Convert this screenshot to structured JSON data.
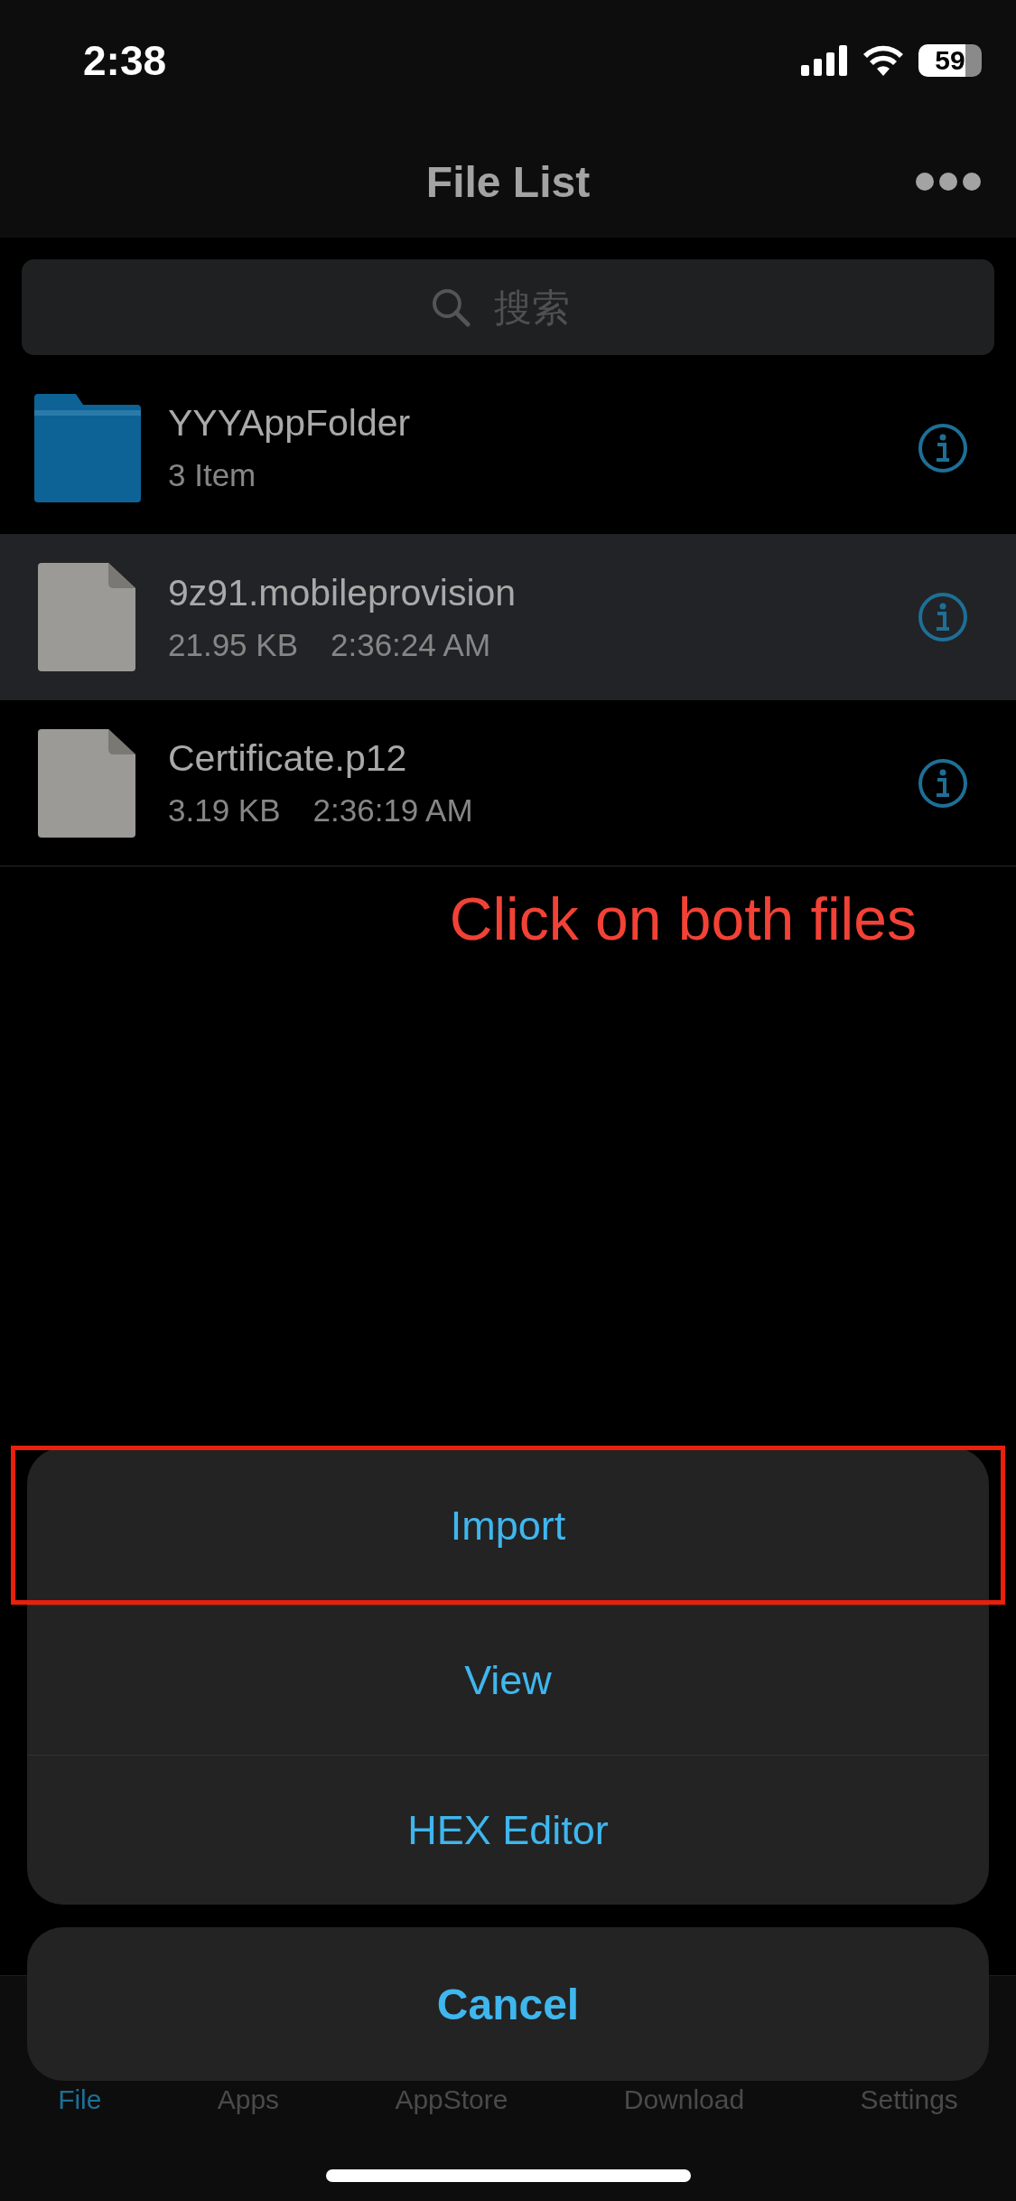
{
  "status_bar": {
    "time": "2:38",
    "battery": "59"
  },
  "nav": {
    "title": "File List"
  },
  "search": {
    "placeholder": "搜索"
  },
  "files": [
    {
      "kind": "folder",
      "name": "YYYAppFolder",
      "details": [
        "3 Item"
      ],
      "selected": false
    },
    {
      "kind": "file",
      "name": "9z91.mobileprovision",
      "details": [
        "21.95 KB",
        "2:36:24 AM"
      ],
      "selected": true
    },
    {
      "kind": "file",
      "name": "Certificate.p12",
      "details": [
        "3.19 KB",
        "2:36:19 AM"
      ],
      "selected": false
    }
  ],
  "annotation": {
    "text": "Click on both files"
  },
  "action_sheet": {
    "actions": [
      {
        "label": "Import",
        "highlighted": true
      },
      {
        "label": "View",
        "highlighted": false
      },
      {
        "label": "HEX Editor",
        "highlighted": false
      }
    ],
    "cancel": "Cancel"
  },
  "tab_bar": [
    {
      "label": "File",
      "selected": true
    },
    {
      "label": "Apps",
      "selected": false
    },
    {
      "label": "AppStore",
      "selected": false
    },
    {
      "label": "Download",
      "selected": false
    },
    {
      "label": "Settings",
      "selected": false
    }
  ]
}
